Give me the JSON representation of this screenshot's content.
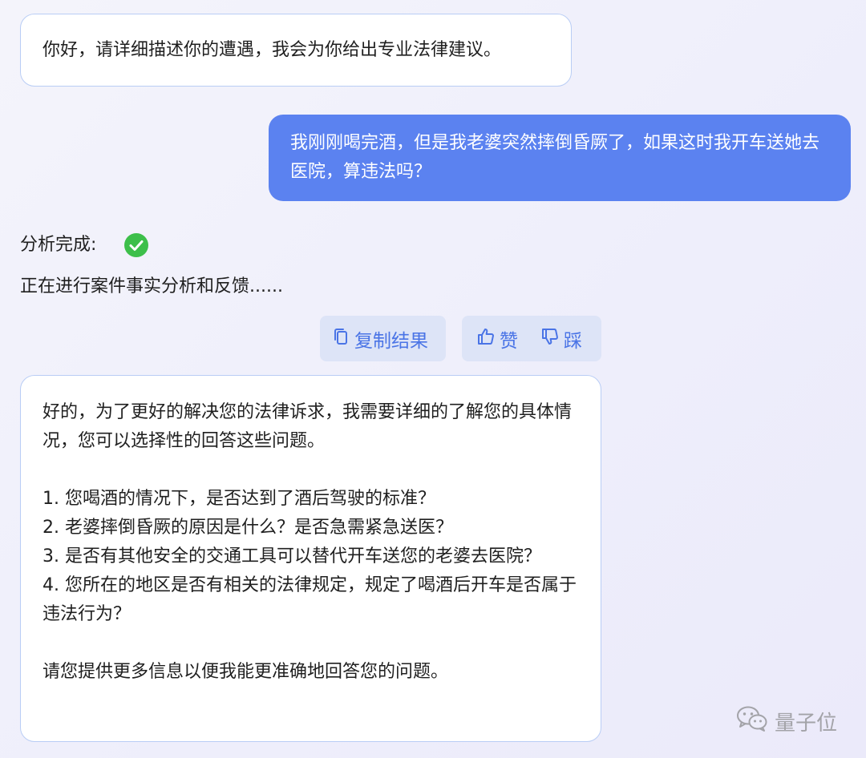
{
  "chat": {
    "greeting": "你好，请详细描述你的遭遇，我会为你给出专业法律建议。",
    "user_message": "我刚刚喝完酒，但是我老婆突然摔倒昏厥了，如果这时我开车送她去医院，算违法吗？",
    "status": {
      "analysis_done_label": "分析完成:",
      "check_icon": "check-circle-icon",
      "check_color": "#3dbf4a",
      "progress_text": "正在进行案件事实分析和反馈......"
    },
    "actions": {
      "copy_label": "复制结果",
      "like_label": "赞",
      "dislike_label": "踩"
    },
    "answer": "好的，为了更好的解决您的法律诉求，我需要详细的了解您的具体情况，您可以选择性的回答这些问题。\n\n1. 您喝酒的情况下，是否达到了酒后驾驶的标准？\n2. 老婆摔倒昏厥的原因是什么？是否急需紧急送医？\n3. 是否有其他安全的交通工具可以替代开车送您的老婆去医院？\n4. 您所在的地区是否有相关的法律规定，规定了喝酒后开车是否属于违法行为？\n\n请您提供更多信息以便我能更准确地回答您的问题。"
  },
  "watermark": {
    "text": "量子位",
    "icon": "wechat-icon"
  },
  "colors": {
    "user_bubble": "#5b82f0",
    "bot_border": "#b9cdf5",
    "action_text": "#4a74e6",
    "action_bg": "#dde4f7"
  }
}
